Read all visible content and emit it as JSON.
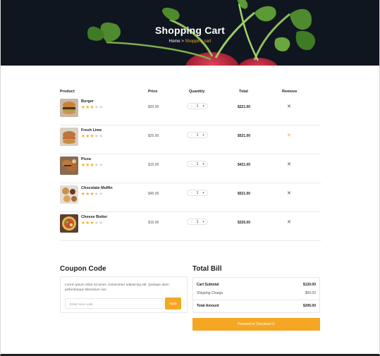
{
  "hero": {
    "title": "Shopping Cart",
    "breadcrumb_home": "Home",
    "breadcrumb_sep": ">",
    "breadcrumb_current": "Shopping cart"
  },
  "table": {
    "headers": [
      "Product",
      "Price",
      "Quantity",
      "Total",
      "Remove"
    ],
    "rows": [
      {
        "name": "Burger",
        "rating": 3,
        "price": "$20.00",
        "qty": "1",
        "total": "$221.00",
        "remove": "✕"
      },
      {
        "name": "Fresh Lime",
        "rating": 3,
        "price": "$25.00",
        "qty": "1",
        "total": "$521.00",
        "remove": "✕"
      },
      {
        "name": "Pizza",
        "rating": 3,
        "price": "$15.00",
        "qty": "1",
        "total": "$421.00",
        "remove": "✕"
      },
      {
        "name": "Chocolate Muffin",
        "rating": 3,
        "price": "$45.00",
        "qty": "1",
        "total": "$521.00",
        "remove": "✕"
      },
      {
        "name": "Cheese Butter",
        "rating": 3,
        "price": "$15.00",
        "qty": "1",
        "total": "$325.00",
        "remove": "✕"
      }
    ],
    "qty_minus": "−",
    "qty_plus": "+"
  },
  "coupon": {
    "title": "Coupon Code",
    "text": "Lorem ipsum dolor sit amet, consectetur adipiscing elit. Quisque diam pellentesque bibendum non",
    "placeholder": "Enter Here code",
    "apply_label": "Apply"
  },
  "bill": {
    "title": "Total Bill",
    "subtotal_label": "Cart Subtotal",
    "subtotal_value": "$120.00",
    "shipping_label": "Shipping Charge",
    "shipping_value": "$00.00",
    "total_label": "Total Amount",
    "total_value": "$205.00",
    "checkout_label": "Proceed to Checkout ☑"
  },
  "colors": {
    "accent": "#f5a623",
    "hero_bg": "#101620"
  },
  "icons": {
    "remove": "close-icon",
    "star": "star-icon"
  }
}
